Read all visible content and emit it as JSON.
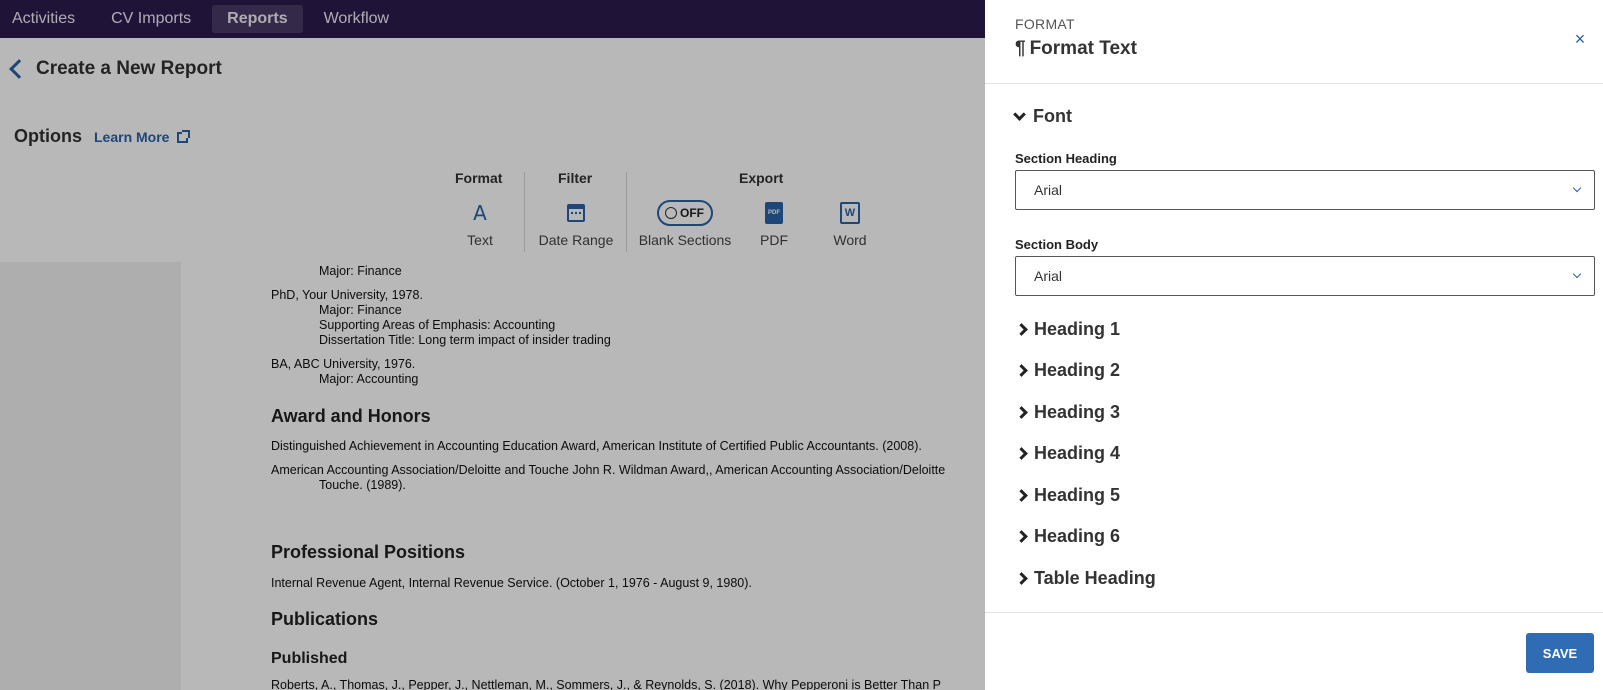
{
  "topnav": {
    "items": [
      "Activities",
      "CV Imports",
      "Reports",
      "Workflow"
    ],
    "active": "Reports"
  },
  "header": {
    "title": "Create a New Report",
    "options_label": "Options",
    "learn_more": "Learn More"
  },
  "toolbar": {
    "groups": {
      "format": "Format",
      "filter": "Filter",
      "export": "Export"
    },
    "text": "Text",
    "date_range": "Date Range",
    "toggle_state": "OFF",
    "blank_sections": "Blank Sections",
    "pdf": "PDF",
    "pdf_icon_text": "PDF",
    "word": "Word",
    "word_icon_text": "W"
  },
  "document": {
    "lines": [
      "Major: Finance",
      "PhD, Your University, 1978.",
      "Major: Finance",
      "Supporting Areas of Emphasis: Accounting",
      "Dissertation Title: Long term impact of insider trading",
      "BA, ABC University, 1976.",
      "Major: Accounting"
    ],
    "awards_heading": "Award and Honors",
    "award1": "Distinguished Achievement in Accounting Education Award, American Institute of Certified Public Accountants. (2008).",
    "award2": "American Accounting Association/Deloitte and Touche John R. Wildman Award,, American Accounting Association/Deloitte",
    "award2_cont": "Touche. (1989).",
    "positions_heading": "Professional Positions",
    "position1": "Internal Revenue Agent, Internal Revenue Service. (October 1, 1976 - August 9, 1980).",
    "publications_heading": "Publications",
    "published_heading": "Published",
    "publication1": "Roberts, A., Thomas, J., Pepper, J., Nettleman, M., Sommers, J., & Reynolds, S. (2018). Why Pepperoni is Better Than P"
  },
  "panel": {
    "eyebrow": "FORMAT",
    "title_icon": "¶",
    "title": "Format Text",
    "close": "×",
    "font_section": "Font",
    "section_heading_label": "Section Heading",
    "section_heading_value": "Arial",
    "section_body_label": "Section Body",
    "section_body_value": "Arial",
    "sections": [
      "Heading 1",
      "Heading 2",
      "Heading 3",
      "Heading 4",
      "Heading 5",
      "Heading 6",
      "Table Heading"
    ],
    "save": "SAVE"
  },
  "colors": {
    "nav_bg": "#2d1b4e",
    "accent": "#2a62a8",
    "save_bg": "#2f6cb3"
  }
}
